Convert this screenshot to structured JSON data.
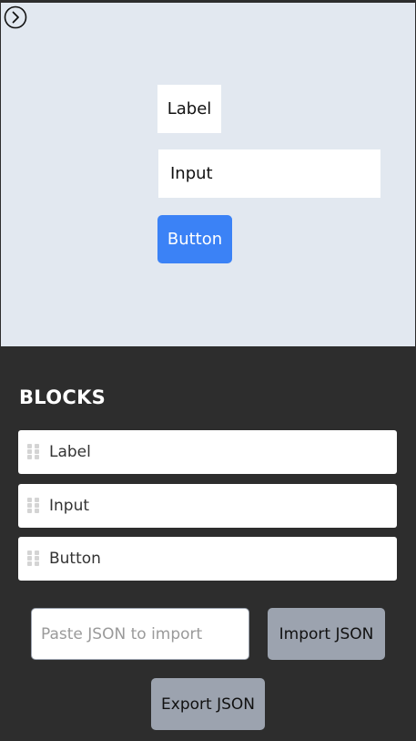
{
  "canvas": {
    "label_text": "Label",
    "input_text": "Input",
    "button_text": "Button",
    "button_color": "#3b82f6",
    "background_color": "#e2e8f0"
  },
  "toggle": {
    "icon": "chevron-right-icon"
  },
  "panel": {
    "title": "BLOCKS",
    "blocks": [
      {
        "label": "Label"
      },
      {
        "label": "Input"
      },
      {
        "label": "Button"
      }
    ],
    "json_input": {
      "placeholder": "Paste JSON to import",
      "value": ""
    },
    "import_label": "Import JSON",
    "export_label": "Export JSON"
  }
}
